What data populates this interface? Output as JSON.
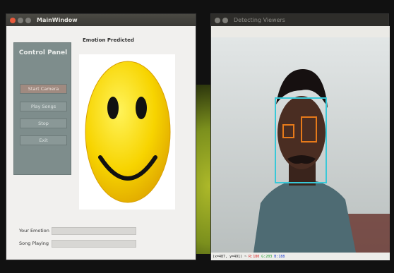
{
  "main_window": {
    "title": "MainWindow",
    "control_panel": {
      "title": "Control Panel",
      "buttons": [
        "Start Camera",
        "Play Songs",
        "Stop",
        "Exit"
      ],
      "active_index": 0
    },
    "emotion_heading": "Emotion Predicted",
    "emotion_image": "smiley-face",
    "fields": [
      {
        "label": "Your Emotion",
        "value": ""
      },
      {
        "label": "Song Playing",
        "value": ""
      }
    ]
  },
  "viewer_window": {
    "title": "Detecting Viewers",
    "status": {
      "coords": "(x=487, y=491) ~",
      "r": "R:180",
      "g": "G:203",
      "b": "B:188"
    },
    "colors": {
      "face_box": "#38c8d8",
      "eye_box": "#e77a1a",
      "r": "#d62020",
      "g": "#1a9a2a",
      "b": "#2040d0"
    }
  }
}
